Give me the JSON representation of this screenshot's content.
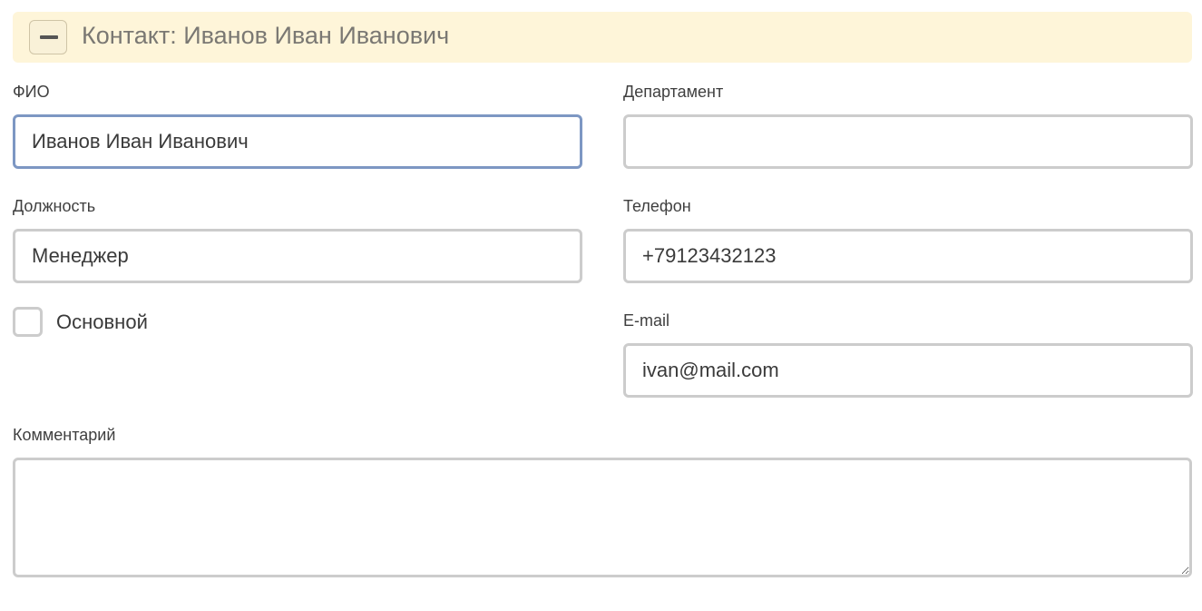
{
  "header": {
    "title": "Контакт: Иванов Иван Иванович",
    "collapse_icon": "minus-icon",
    "background": "#fef5d9"
  },
  "fields": {
    "fio": {
      "label": "ФИО",
      "value": "Иванов Иван Иванович"
    },
    "department": {
      "label": "Департамент",
      "value": ""
    },
    "position": {
      "label": "Должность",
      "value": "Менеджер"
    },
    "phone": {
      "label": "Телефон",
      "value": "+79123432123"
    },
    "email": {
      "label": "E-mail",
      "value": "ivan@mail.com"
    },
    "primary": {
      "label": "Основной",
      "checked": false
    },
    "comment": {
      "label": "Комментарий",
      "value": ""
    }
  },
  "colors": {
    "focus_border": "#7d97c3",
    "input_border": "#cccccc"
  }
}
